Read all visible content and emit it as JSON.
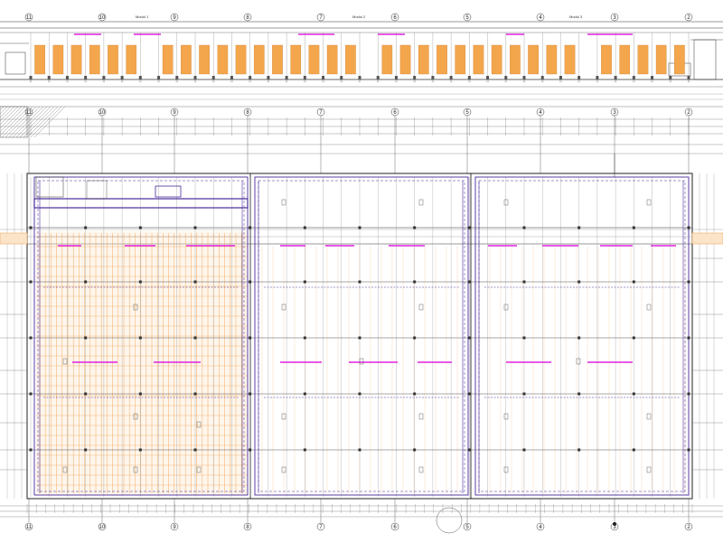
{
  "drawing": {
    "module_labels": [
      "Modul 1",
      "Modul 2",
      "Modul 3"
    ],
    "axis_labels": [
      "11",
      "10",
      "9",
      "8",
      "7",
      "6",
      "5",
      "4",
      "3",
      "2"
    ],
    "colors": {
      "background": "#ffffff",
      "line": "#333333",
      "grid": "#9a9a9a",
      "orange_fill": "#f4a64d",
      "orange_line": "#f0a050",
      "purple": "#4a2a9a",
      "magenta": "#e020e0",
      "hatch": "#777777"
    }
  }
}
